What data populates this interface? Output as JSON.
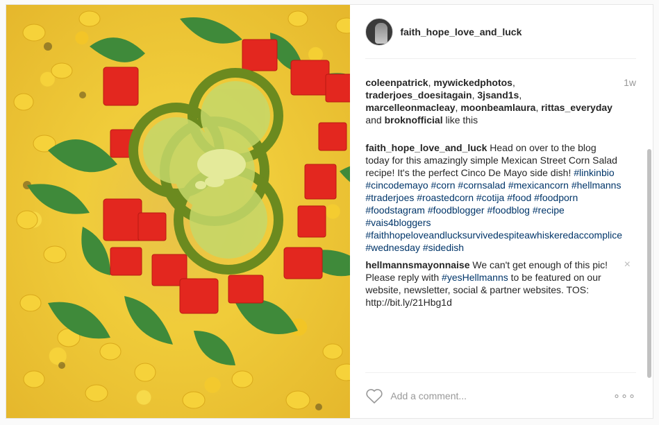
{
  "post": {
    "username": "faith_hope_love_and_luck",
    "time_ago": "1w",
    "likes_prefix_users": [
      "coleenpatrick",
      "mywickedphotos",
      "traderjoes_doesitagain",
      "3jsand1s",
      "marcelleonmacleay",
      "moonbeamlaura",
      "rittas_everyday"
    ],
    "likes_and": "and",
    "likes_last_user": "broknofficial",
    "likes_suffix": "like this"
  },
  "caption": {
    "user": "faith_hope_love_and_luck",
    "text": "Head on over to the blog today for this amazingly simple Mexican Street Corn Salad recipe! It's the perfect Cinco De Mayo side dish!",
    "hashtags": [
      "#linkinbio",
      "#cincodemayo",
      "#corn",
      "#cornsalad",
      "#mexicancorn",
      "#hellmanns",
      "#traderjoes",
      "#roastedcorn",
      "#cotija",
      "#food",
      "#foodporn",
      "#foodstagram",
      "#foodblogger",
      "#foodblog",
      "#recipe",
      "#vais4bloggers",
      "#faithhopeloveandlucksurvivedespiteawhiskeredaccomplice",
      "#wednesday",
      "#sidedish"
    ]
  },
  "comment2": {
    "user": "hellmannsmayonnaise",
    "text_before": "We can't get enough of this pic! Please reply with",
    "hashtag": "#yesHellmanns",
    "text_after": "to be featured on our website, newsletter, social & partner websites. TOS: http://bit.ly/21Hbg1d",
    "close_glyph": "×"
  },
  "footer": {
    "comment_placeholder": "Add a comment...",
    "more_glyph": "∘∘∘",
    "like_icon": "heart-outline-icon"
  },
  "colors": {
    "link": "#003569",
    "muted": "#999999",
    "text": "#262626"
  }
}
